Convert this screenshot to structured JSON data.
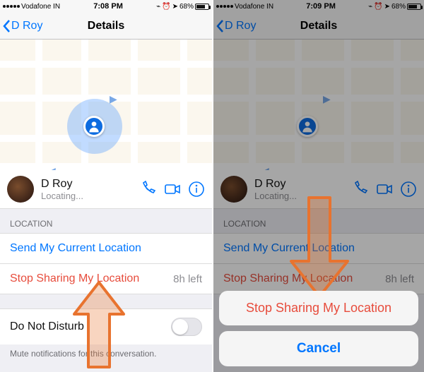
{
  "left": {
    "status": {
      "carrier": "Vodafone IN",
      "time": "7:08 PM",
      "battery": "68%"
    },
    "nav": {
      "back": "D Roy",
      "title": "Details"
    },
    "contact": {
      "name": "D Roy",
      "status": "Locating..."
    },
    "section_location": "LOCATION",
    "row_send": "Send My Current Location",
    "row_stop": "Stop Sharing My Location",
    "row_stop_time": "8h left",
    "row_dnd": "Do Not Disturb",
    "footnote": "Mute notifications for this conversation."
  },
  "right": {
    "status": {
      "carrier": "Vodafone IN",
      "time": "7:09 PM",
      "battery": "68%"
    },
    "nav": {
      "back": "D Roy",
      "title": "Details"
    },
    "contact": {
      "name": "D Roy",
      "status": "Locating..."
    },
    "section_location": "LOCATION",
    "row_send": "Send My Current Location",
    "row_stop": "Stop Sharing My Location",
    "row_stop_time": "8h left",
    "sheet": {
      "stop": "Stop Sharing My Location",
      "cancel": "Cancel"
    }
  }
}
